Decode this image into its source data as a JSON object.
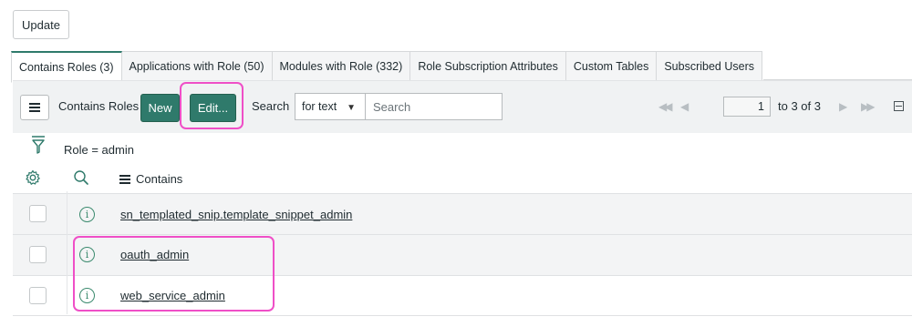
{
  "form": {
    "update_label": "Update"
  },
  "tabs": [
    {
      "label": "Contains Roles (3)",
      "active": true
    },
    {
      "label": "Applications with Role (50)",
      "active": false
    },
    {
      "label": "Modules with Role (332)",
      "active": false
    },
    {
      "label": "Role Subscription Attributes",
      "active": false
    },
    {
      "label": "Custom Tables",
      "active": false
    },
    {
      "label": "Subscribed Users",
      "active": false
    }
  ],
  "list": {
    "title": "Contains Roles",
    "new_label": "New",
    "edit_label": "Edit...",
    "search_label": "Search",
    "search_type": "for text",
    "search_placeholder": "Search",
    "page_value": "1",
    "page_of": "to 3 of 3",
    "filter": "Role = admin",
    "column_header": "Contains",
    "rows": [
      {
        "name": "sn_templated_snip.template_snippet_admin"
      },
      {
        "name": "oauth_admin"
      },
      {
        "name": "web_service_admin"
      }
    ]
  },
  "icons": {
    "list_menu": "hamburger-menu-icon",
    "funnel": "funnel-filter-icon",
    "gear": "gear-icon",
    "search": "search-icon",
    "info": "info-circle-icon",
    "first": "first-page-icon",
    "prev": "previous-page-icon",
    "next": "next-page-icon",
    "last": "last-page-icon",
    "collapse": "collapse-icon"
  },
  "colors": {
    "accent": "#2f7a6b",
    "highlight": "#ef4fc7",
    "info_icon": "#3b8a6e"
  }
}
